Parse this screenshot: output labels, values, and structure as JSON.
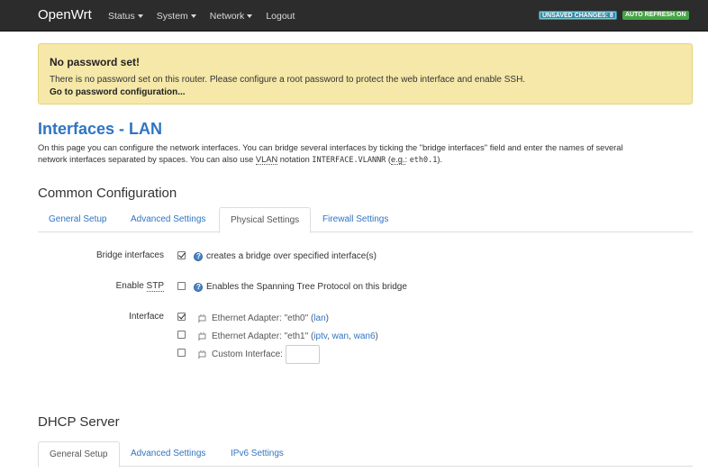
{
  "nav": {
    "brand": "OpenWrt",
    "menu": [
      "Status",
      "System",
      "Network",
      "Logout"
    ],
    "badge_unsaved": "UNSAVED CHANGES: 8",
    "badge_refresh": "AUTO REFRESH ON"
  },
  "alert": {
    "title": "No password set!",
    "text": "There is no password set on this router. Please configure a root password to protect the web interface and enable SSH.",
    "link": "Go to password configuration..."
  },
  "page": {
    "title": "Interfaces - LAN",
    "desc_1": "On this page you can configure the network interfaces. You can bridge several interfaces by ticking the \"bridge interfaces\" field and enter the names of several",
    "desc_2a": "network interfaces separated by spaces. You can also use ",
    "desc_vlan": "VLAN",
    "desc_2b": " notation ",
    "desc_code1": "INTERFACE.VLANNR",
    "desc_2c": " (",
    "desc_eg": "e.g.",
    "desc_2d": ": ",
    "desc_code2": "eth0.1",
    "desc_2e": ")."
  },
  "common": {
    "title": "Common Configuration",
    "tabs": [
      "General Setup",
      "Advanced Settings",
      "Physical Settings",
      "Firewall Settings"
    ],
    "active_tab": "Physical Settings"
  },
  "form": {
    "bridge_label": "Bridge interfaces",
    "bridge_checked": true,
    "bridge_help": "creates a bridge over specified interface(s)",
    "stp_label_prefix": "Enable ",
    "stp_abbr": "STP",
    "stp_checked": false,
    "stp_help": "Enables the Spanning Tree Protocol on this bridge",
    "interface_label": "Interface",
    "interfaces": [
      {
        "checked": true,
        "prefix": "Ethernet Adapter: \"eth0\" (",
        "links": [
          "lan"
        ],
        "suffix": ")"
      },
      {
        "checked": false,
        "prefix": "Ethernet Adapter: \"eth1\" (",
        "links": [
          "iptv",
          "wan",
          "wan6"
        ],
        "suffix": ")"
      }
    ],
    "custom_label": "Custom Interface:",
    "custom_value": ""
  },
  "dhcp": {
    "title": "DHCP Server",
    "tabs": [
      "General Setup",
      "Advanced Settings",
      "IPv6 Settings"
    ],
    "active_tab": "General Setup"
  },
  "colors": {
    "navbar": "#2c2c2c",
    "link": "#2f74c3",
    "alert_bg": "#f5e8a8",
    "badge_unsaved": "#3a87ad",
    "badge_refresh": "#46a546"
  }
}
